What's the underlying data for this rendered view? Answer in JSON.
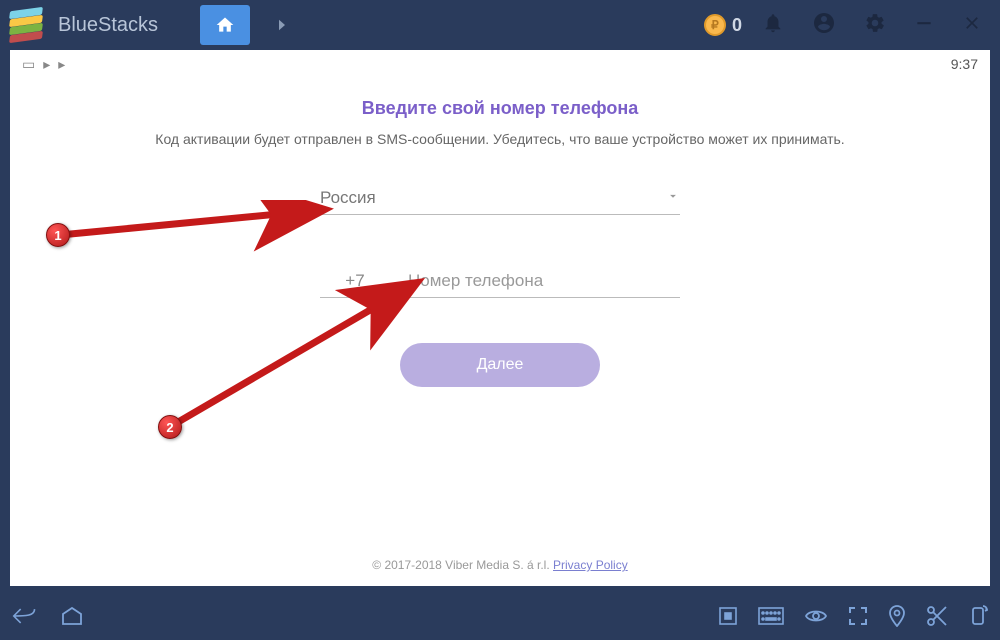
{
  "app": {
    "title": "BlueStacks",
    "coins": "0"
  },
  "status": {
    "time": "9:37"
  },
  "viber": {
    "title": "Введите свой номер телефона",
    "subtitle": "Код активации будет отправлен в SMS-сообщении. Убедитесь, что ваше устройство может их принимать.",
    "country": "Россия",
    "dial_code": "+7",
    "phone_placeholder": "Номер телефона",
    "next_label": "Далее",
    "footer_copyright": "© 2017-2018 Viber Media S. á r.l. ",
    "footer_privacy": "Privacy Policy"
  },
  "annotations": {
    "bubble1": "1",
    "bubble2": "2"
  }
}
